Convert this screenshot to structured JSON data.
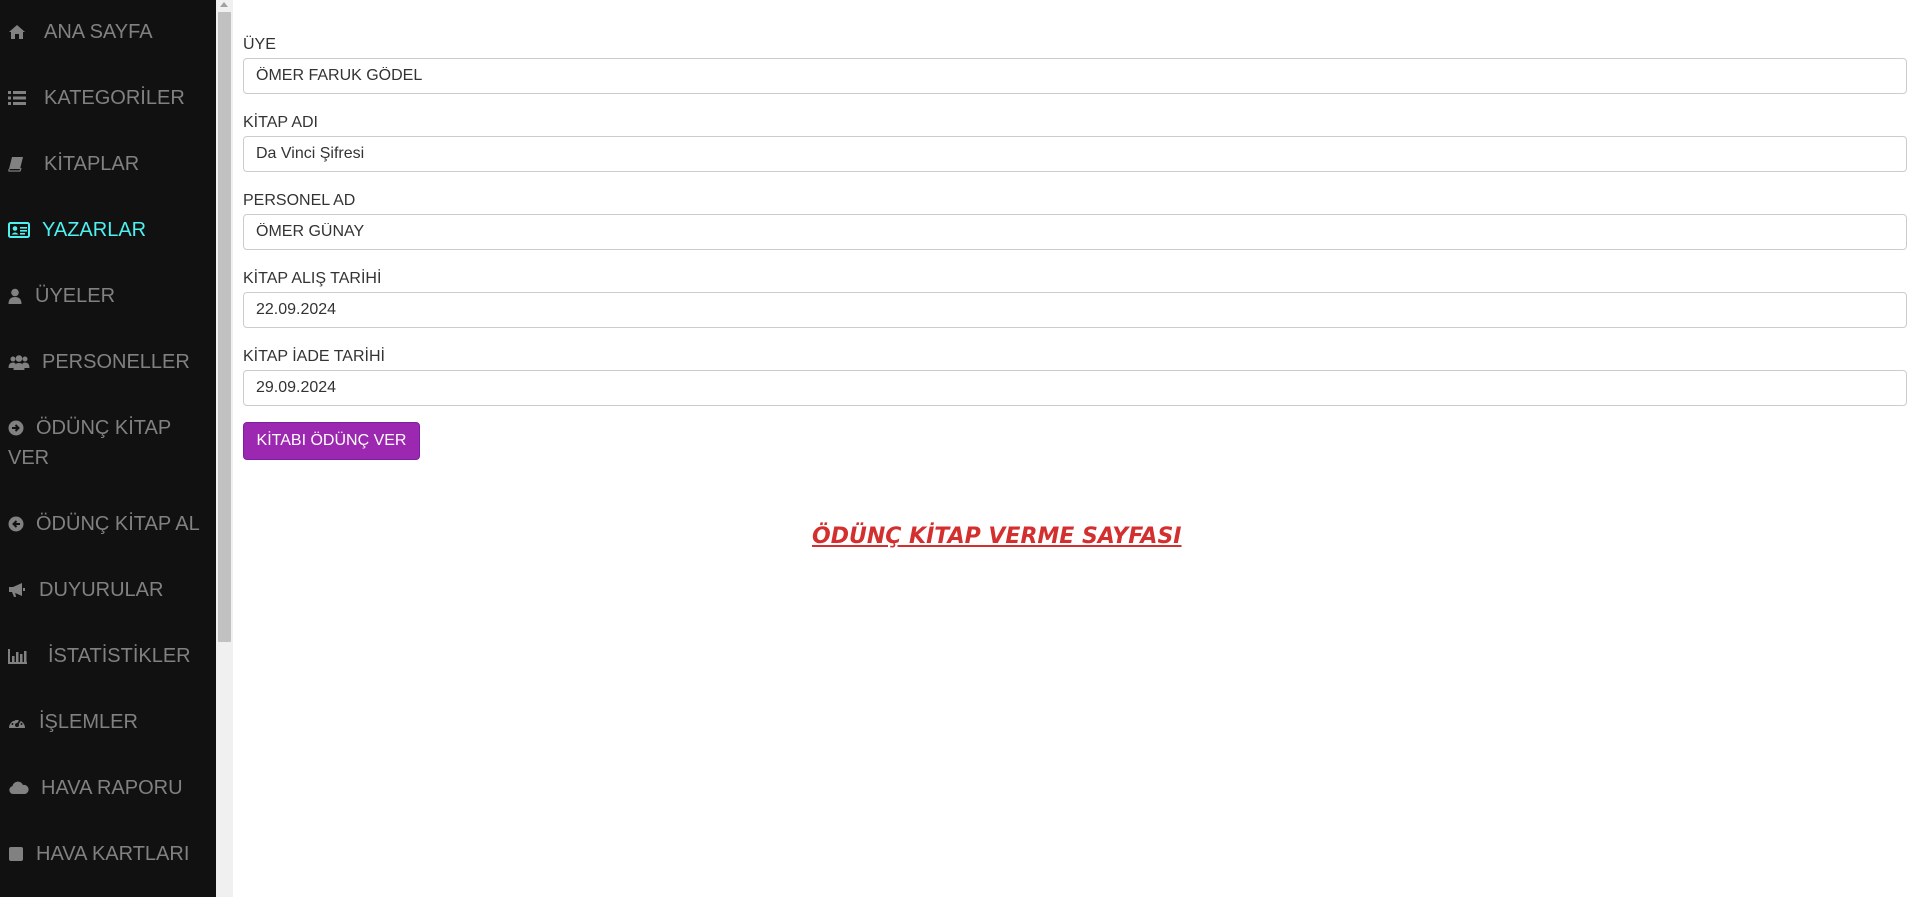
{
  "sidebar": {
    "items": [
      {
        "label": "ANA SAYFA",
        "icon": "home-icon",
        "active": false
      },
      {
        "label": "KATEGORİLER",
        "icon": "list-icon",
        "active": false
      },
      {
        "label": "KİTAPLAR",
        "icon": "book-icon",
        "active": false
      },
      {
        "label": "YAZARLAR",
        "icon": "id-card-icon",
        "active": true
      },
      {
        "label": "ÜYELER",
        "icon": "user-icon",
        "active": false
      },
      {
        "label": "PERSONELLER",
        "icon": "users-icon",
        "active": false
      },
      {
        "label": "ÖDÜNÇ KİTAP",
        "label_line2": "VER",
        "icon": "arrow-circle-right-icon",
        "active": false
      },
      {
        "label": "ÖDÜNÇ KİTAP AL",
        "icon": "arrow-circle-left-icon",
        "active": false
      },
      {
        "label": "DUYURULAR",
        "icon": "bullhorn-icon",
        "active": false
      },
      {
        "label": "İSTATİSTİKLER",
        "icon": "bar-chart-icon",
        "active": false
      },
      {
        "label": "İŞLEMLER",
        "icon": "dashboard-icon",
        "active": false
      },
      {
        "label": "HAVA RAPORU",
        "icon": "cloud-icon",
        "active": false
      },
      {
        "label": "HAVA KARTLARI",
        "icon": "square-icon",
        "active": false
      }
    ],
    "colors": {
      "background": "#111111",
      "text": "#818181",
      "active": "#4ef0f0"
    }
  },
  "form": {
    "fields": [
      {
        "label": "ÜYE",
        "value": "ÖMER FARUK GÖDEL"
      },
      {
        "label": "KİTAP ADI",
        "value": "Da Vinci Şifresi"
      },
      {
        "label": "PERSONEL AD",
        "value": "ÖMER GÜNAY"
      },
      {
        "label": "KİTAP ALIŞ TARİHİ",
        "value": "22.09.2024"
      },
      {
        "label": "KİTAP İADE TARİHİ",
        "value": "29.09.2024"
      }
    ],
    "submit_label": "KİTABI ÖDÜNÇ VER",
    "submit_color": "#9c27b0"
  },
  "page_heading": "ÖDÜNÇ KİTAP VERME SAYFASI",
  "page_heading_color": "#d32f2f"
}
